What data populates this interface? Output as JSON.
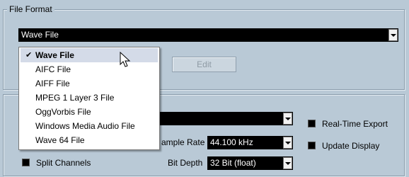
{
  "file_format": {
    "legend": "File Format",
    "format_value": "Wave File",
    "edit_button": "Edit",
    "options": [
      "Wave File",
      "AIFC File",
      "AIFF File",
      "MPEG 1 Layer 3 File",
      "OggVorbis File",
      "Windows Media Audio File",
      "Wave 64 File"
    ],
    "selected_option": "Wave File"
  },
  "attributes": {
    "legend_fragment": "",
    "sample_rate_label": "ample Rate",
    "sample_rate_value": "44.100 kHz",
    "bit_depth_label": "Bit Depth",
    "bit_depth_value": "32 Bit (float)",
    "split_channels_label": "Split Channels",
    "real_time_export_label": "Real-Time Export",
    "update_display_label": "Update Display"
  },
  "icons": {
    "checkmark": "checkmark-icon",
    "cursor": "mouse-pointer-icon",
    "dropdown_arrow": "chevron-down-icon"
  },
  "colors": {
    "panel_bg": "#b9c9d6",
    "field_bg": "#000000",
    "field_text": "#ffffff",
    "menu_highlight": "#d4dbe8"
  }
}
